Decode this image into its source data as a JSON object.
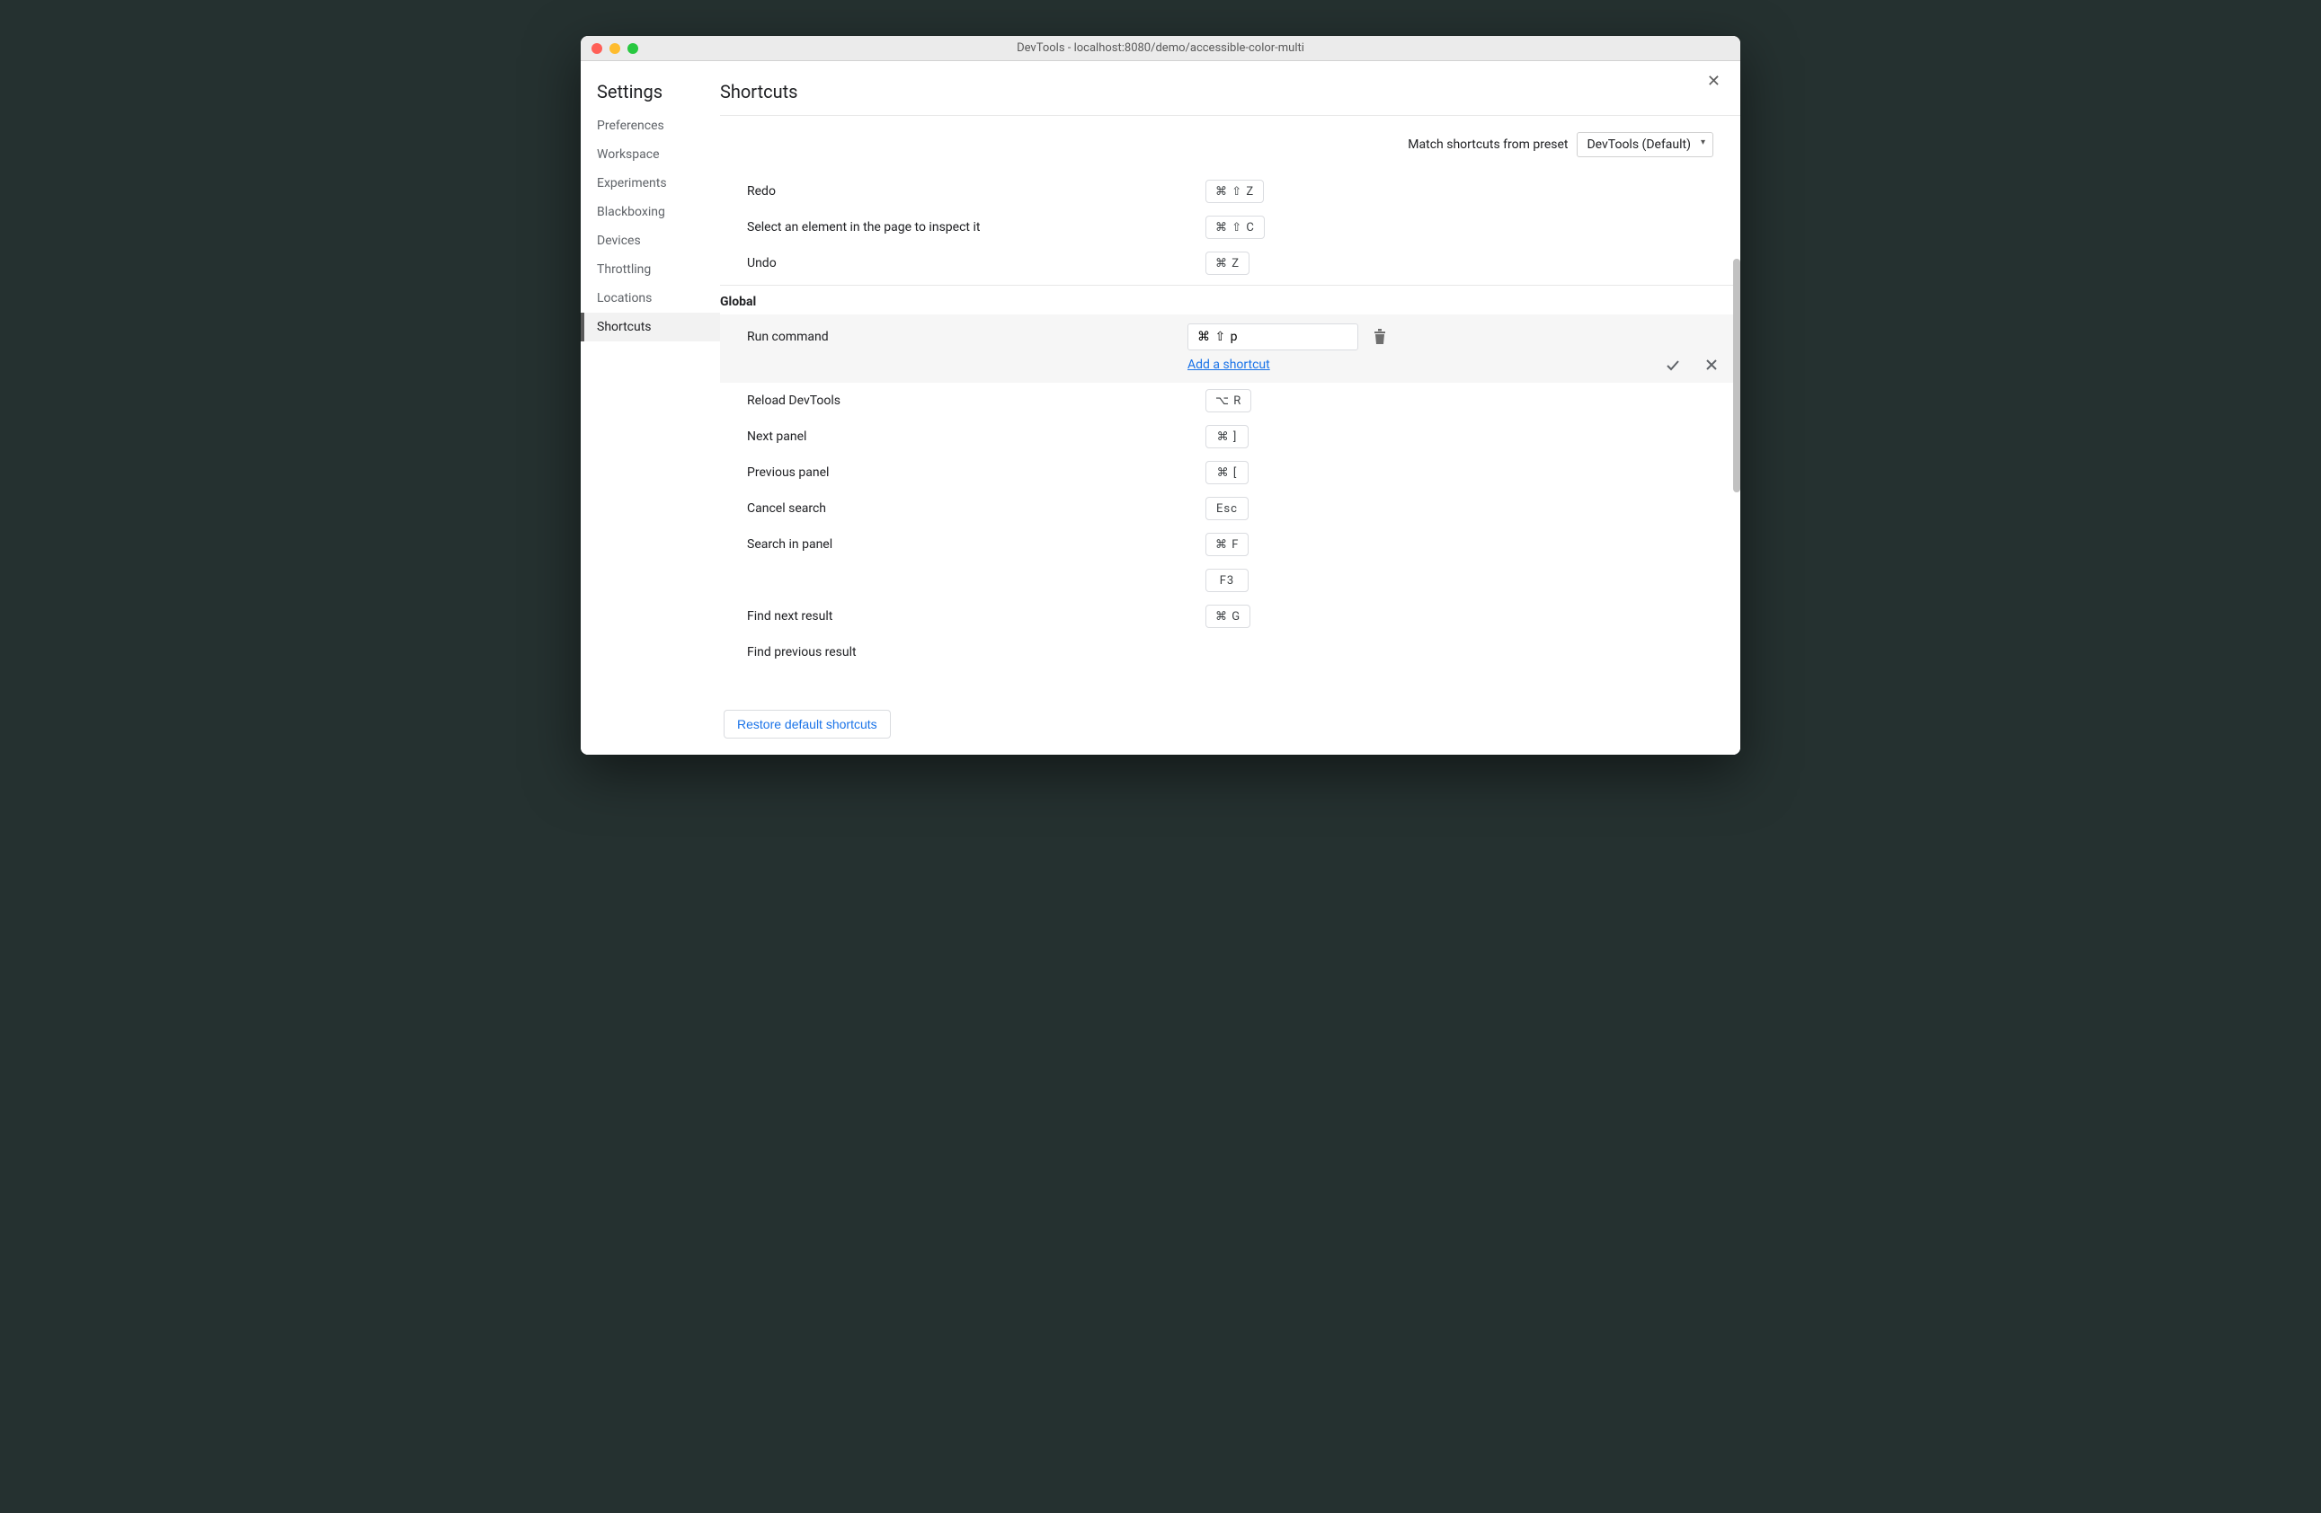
{
  "windowTitle": "DevTools - localhost:8080/demo/accessible-color-multi",
  "sidebar": {
    "title": "Settings",
    "items": [
      "Preferences",
      "Workspace",
      "Experiments",
      "Blackboxing",
      "Devices",
      "Throttling",
      "Locations",
      "Shortcuts"
    ],
    "activeIndex": 7
  },
  "page": {
    "title": "Shortcuts",
    "presetLabel": "Match shortcuts from preset",
    "presetValue": "DevTools (Default)",
    "restoreLabel": "Restore default shortcuts"
  },
  "topShortcuts": [
    {
      "label": "Redo",
      "keys": "⌘ ⇧ Z"
    },
    {
      "label": "Select an element in the page to inspect it",
      "keys": "⌘ ⇧ C"
    },
    {
      "label": "Undo",
      "keys": "⌘ Z"
    }
  ],
  "groupHeader": "Global",
  "editRow": {
    "label": "Run command",
    "value": "⌘ ⇧ p",
    "addLink": "Add a shortcut"
  },
  "bottomShortcuts": [
    {
      "label": "Reload DevTools",
      "keys": "⌥ R"
    },
    {
      "label": "Next panel",
      "keys": "⌘ ]"
    },
    {
      "label": "Previous panel",
      "keys": "⌘ ["
    },
    {
      "label": "Cancel search",
      "keys": "Esc"
    },
    {
      "label": "Search in panel",
      "keys": "⌘ F"
    },
    {
      "label": "",
      "keys": "F3"
    },
    {
      "label": "Find next result",
      "keys": "⌘ G"
    },
    {
      "label": "Find previous result",
      "keys": ""
    }
  ]
}
